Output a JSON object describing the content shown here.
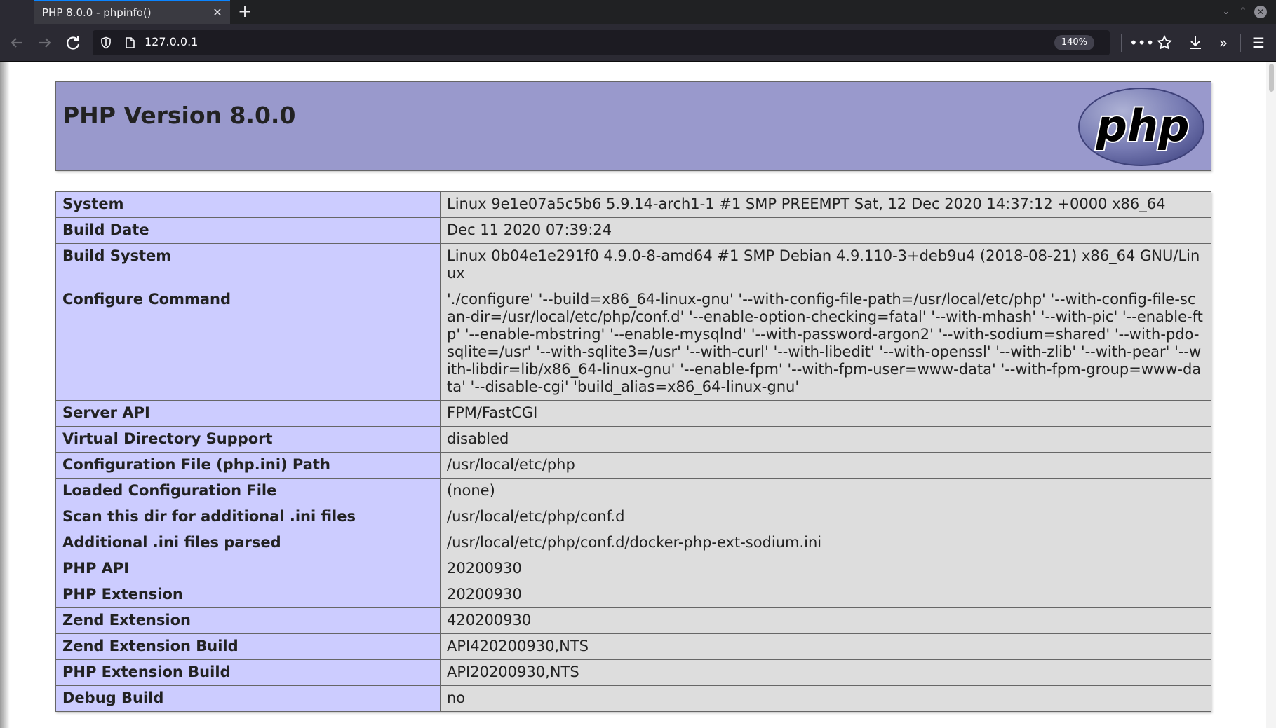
{
  "browser": {
    "tab_title": "PHP 8.0.0 - phpinfo()",
    "url": "127.0.0.1",
    "zoom": "140%"
  },
  "page": {
    "heading": "PHP Version 8.0.0",
    "logo_text": "php",
    "rows": [
      {
        "label": "System",
        "value": "Linux 9e1e07a5c5b6 5.9.14-arch1-1 #1 SMP PREEMPT Sat, 12 Dec 2020 14:37:12 +0000 x86_64"
      },
      {
        "label": "Build Date",
        "value": "Dec 11 2020 07:39:24"
      },
      {
        "label": "Build System",
        "value": "Linux 0b04e1e291f0 4.9.0-8-amd64 #1 SMP Debian 4.9.110-3+deb9u4 (2018-08-21) x86_64 GNU/Linux"
      },
      {
        "label": "Configure Command",
        "value": "'./configure' '--build=x86_64-linux-gnu' '--with-config-file-path=/usr/local/etc/php' '--with-config-file-scan-dir=/usr/local/etc/php/conf.d' '--enable-option-checking=fatal' '--with-mhash' '--with-pic' '--enable-ftp' '--enable-mbstring' '--enable-mysqlnd' '--with-password-argon2' '--with-sodium=shared' '--with-pdo-sqlite=/usr' '--with-sqlite3=/usr' '--with-curl' '--with-libedit' '--with-openssl' '--with-zlib' '--with-pear' '--with-libdir=lib/x86_64-linux-gnu' '--enable-fpm' '--with-fpm-user=www-data' '--with-fpm-group=www-data' '--disable-cgi' 'build_alias=x86_64-linux-gnu'"
      },
      {
        "label": "Server API",
        "value": "FPM/FastCGI"
      },
      {
        "label": "Virtual Directory Support",
        "value": "disabled"
      },
      {
        "label": "Configuration File (php.ini) Path",
        "value": "/usr/local/etc/php"
      },
      {
        "label": "Loaded Configuration File",
        "value": "(none)"
      },
      {
        "label": "Scan this dir for additional .ini files",
        "value": "/usr/local/etc/php/conf.d"
      },
      {
        "label": "Additional .ini files parsed",
        "value": "/usr/local/etc/php/conf.d/docker-php-ext-sodium.ini"
      },
      {
        "label": "PHP API",
        "value": "20200930"
      },
      {
        "label": "PHP Extension",
        "value": "20200930"
      },
      {
        "label": "Zend Extension",
        "value": "420200930"
      },
      {
        "label": "Zend Extension Build",
        "value": "API420200930,NTS"
      },
      {
        "label": "PHP Extension Build",
        "value": "API20200930,NTS"
      },
      {
        "label": "Debug Build",
        "value": "no"
      }
    ]
  },
  "icons": {
    "back": "arrow-left-icon",
    "forward": "arrow-right-icon",
    "reload": "reload-icon",
    "shield": "tracking-protection-shield-icon",
    "page": "page-info-icon",
    "more": "ellipsis-icon",
    "bookmark": "star-icon",
    "download": "download-icon",
    "overflow": "chevron-double-right-icon",
    "menu": "hamburger-menu-icon"
  },
  "colors": {
    "header_bg": "#9999cc",
    "label_bg": "#ccccff",
    "value_bg": "#dddddd",
    "browser_dark": "#2b2a33"
  }
}
